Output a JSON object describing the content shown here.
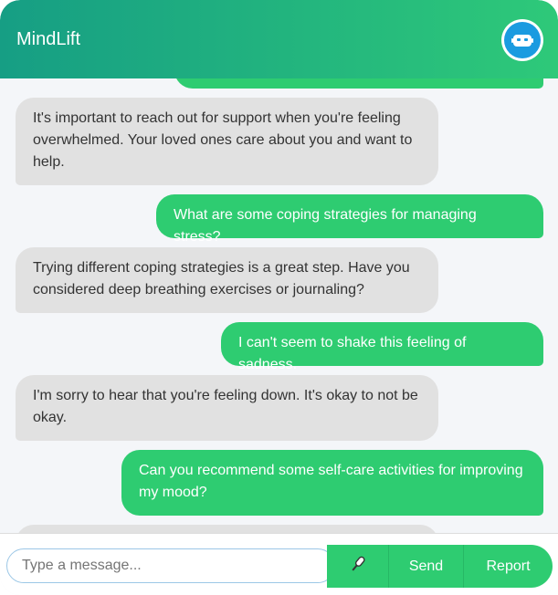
{
  "app": {
    "title": "MindLift",
    "header_gradient": [
      "#169e84",
      "#2ec979"
    ],
    "avatar_icon": "robot-icon",
    "avatar_color": "#1a9be0"
  },
  "colors": {
    "bot_bubble": "#e1e1e1",
    "user_bubble": "#2ecc71",
    "accent": "#2ecc71"
  },
  "messages": [
    {
      "role": "user",
      "text": ""
    },
    {
      "role": "bot",
      "text": "It's important to reach out for support when you're feeling overwhelmed. Your loved ones care about you and want to help."
    },
    {
      "role": "user",
      "text": "What are some coping strategies for managing stress?"
    },
    {
      "role": "bot",
      "text": "Trying different coping strategies is a great step. Have you considered deep breathing exercises or journaling?"
    },
    {
      "role": "user",
      "text": "I can't seem to shake this feeling of sadness."
    },
    {
      "role": "bot",
      "text": "I'm sorry to hear that you're feeling down. It's okay to not be okay."
    },
    {
      "role": "user",
      "text": "Can you recommend some self-care activities for improving my mood?"
    },
    {
      "role": "bot",
      "text": ""
    }
  ],
  "composer": {
    "placeholder": "Type a message...",
    "value": "",
    "mic_icon": "microphone-icon",
    "send_label": "Send",
    "report_label": "Report"
  }
}
